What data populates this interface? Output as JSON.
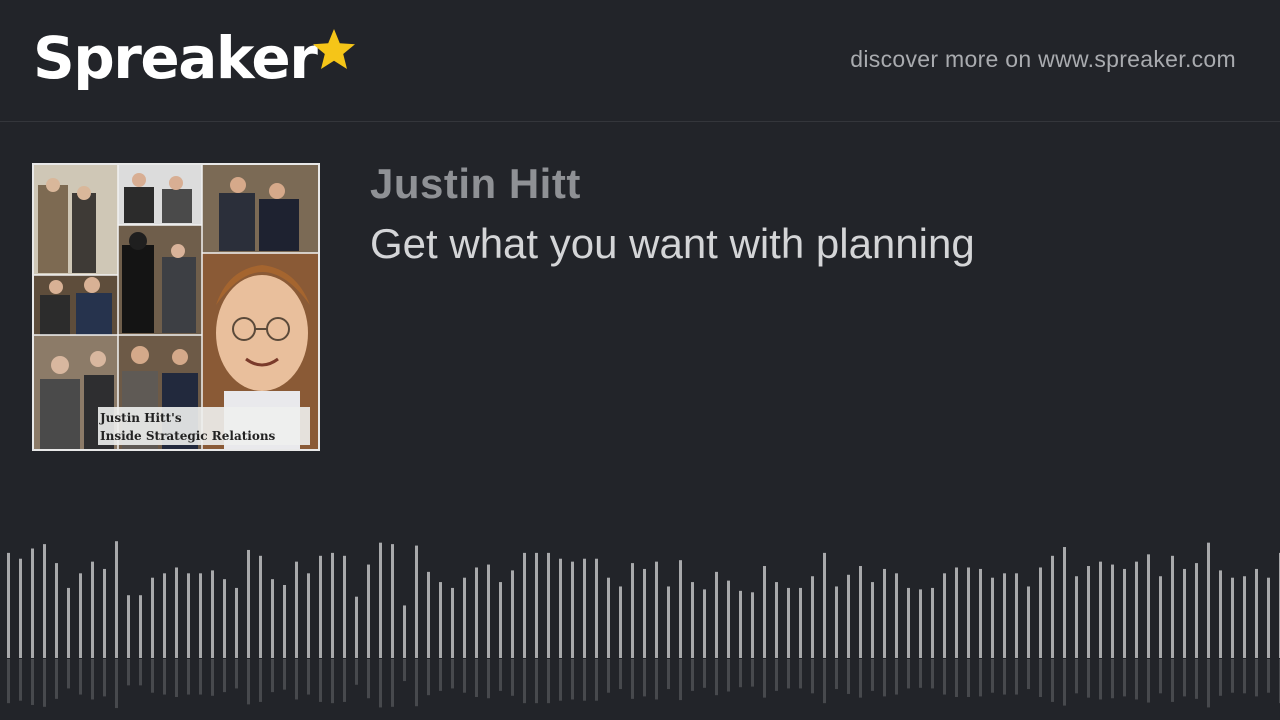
{
  "header": {
    "logo_text": "Spreaker",
    "logo_star_color": "#f5c518",
    "discover_text": "discover more on www.spreaker.com"
  },
  "episode": {
    "author": "Justin Hitt",
    "title": "Get what you want with planning",
    "cover": {
      "caption_line1": "Justin Hitt's",
      "caption_line2": "Inside Strategic Relations"
    }
  },
  "waveform": {
    "bar_color": "#a8a9ab",
    "levels": [
      0.72,
      0.68,
      0.75,
      0.78,
      0.65,
      0.48,
      0.58,
      0.66,
      0.61,
      0.8,
      0.43,
      0.43,
      0.55,
      0.58,
      0.62,
      0.58,
      0.58,
      0.6,
      0.54,
      0.48,
      0.74,
      0.7,
      0.54,
      0.5,
      0.66,
      0.58,
      0.7,
      0.72,
      0.7,
      0.42,
      0.64,
      0.79,
      0.78,
      0.36,
      0.77,
      0.59,
      0.52,
      0.48,
      0.55,
      0.62,
      0.64,
      0.52,
      0.6,
      0.72,
      0.72,
      0.72,
      0.68,
      0.66,
      0.68,
      0.68,
      0.55,
      0.49,
      0.65,
      0.61,
      0.66,
      0.49,
      0.67,
      0.52,
      0.47,
      0.59,
      0.53,
      0.46,
      0.45,
      0.63,
      0.52,
      0.48,
      0.48,
      0.56,
      0.72,
      0.49,
      0.57,
      0.63,
      0.52,
      0.61,
      0.58,
      0.48,
      0.47,
      0.48,
      0.58,
      0.62,
      0.62,
      0.61,
      0.55,
      0.58,
      0.58,
      0.49,
      0.62,
      0.7,
      0.76,
      0.56,
      0.63,
      0.66,
      0.64,
      0.61,
      0.66,
      0.71,
      0.56,
      0.7,
      0.61,
      0.65,
      0.79,
      0.6,
      0.55,
      0.56,
      0.61,
      0.55,
      0.72,
      0.66,
      0.64,
      0.64,
      0.64,
      0.57,
      0.59,
      0.7,
      0.46
    ]
  }
}
